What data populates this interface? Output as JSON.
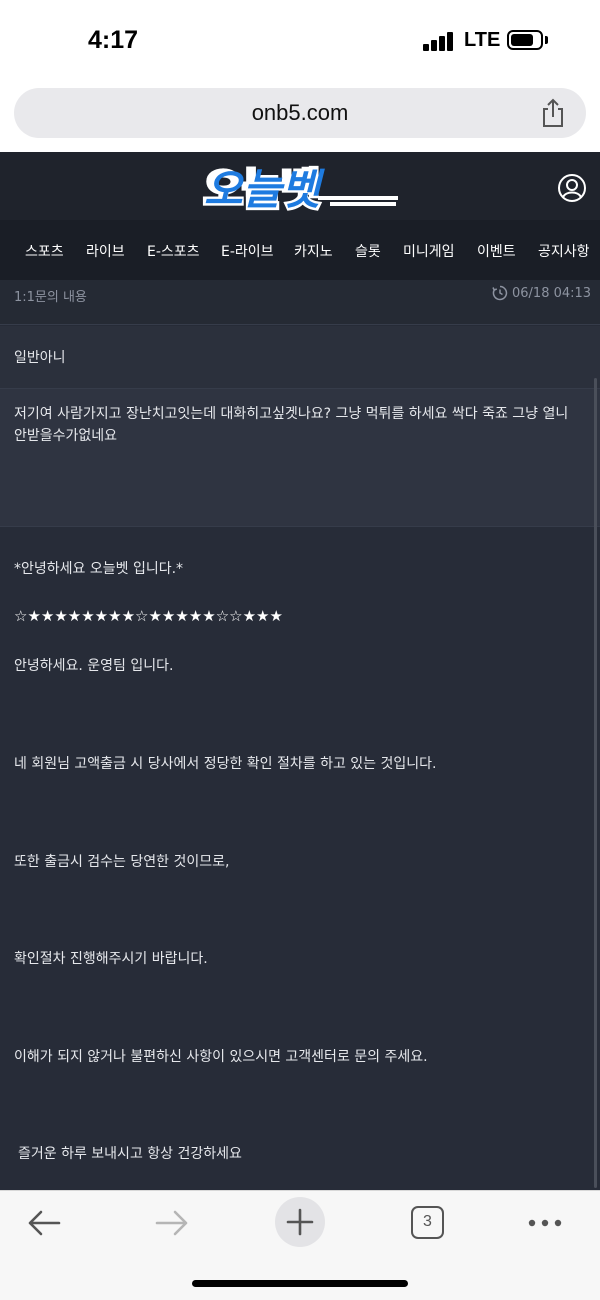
{
  "status_bar": {
    "time": "4:17",
    "network": "LTE"
  },
  "browser": {
    "url": "onb5.com",
    "tab_count": "3"
  },
  "site": {
    "logo_text": "오늘벳",
    "nav": [
      "스포츠",
      "라이브",
      "E-스포츠",
      "E-라이브",
      "카지노",
      "슬롯",
      "미니게임",
      "이벤트",
      "공지사항"
    ]
  },
  "inquiry": {
    "label": "1:1문의 내용",
    "timestamp": "06/18 04:13",
    "subject": "일반아니",
    "body": "저기여 사람가지고 장난치고잇는데 대화히고싶겟나요? 그냥 먹튀를 하세요  싹다 죽죠 그냥 열니 안받을수가없네요",
    "reply": {
      "greeting": "*안녕하세요 오늘벳 입니다.*",
      "stars": "☆★★★★★★★★☆★★★★★☆☆★★★",
      "line1": "안녕하세요. 운영팀 입니다.",
      "line2": "네 회원님 고액출금 시 당사에서 정당한 확인 절차를 하고 있는 것입니다.",
      "line3": "또한 출금시 검수는 당연한 것이므로,",
      "line4": "확인절차 진행해주시기 바랍니다.",
      "line5": "이해가 되지 않거나 불편하신 사항이 있으시면 고객센터로 문의 주세요.",
      "line6": "즐거운 하루 보내시고 항상 건강하세요"
    }
  },
  "colors": {
    "logo_blue": "#1e7be0",
    "header_bg": "#1f232c",
    "content_bg": "#262b37"
  },
  "icons": {
    "share": "share-icon",
    "profile": "user-circle-icon",
    "clock": "clock-icon",
    "back": "arrow-left-icon",
    "forward": "arrow-right-icon",
    "new_tab": "plus-icon",
    "more": "ellipsis-icon"
  }
}
